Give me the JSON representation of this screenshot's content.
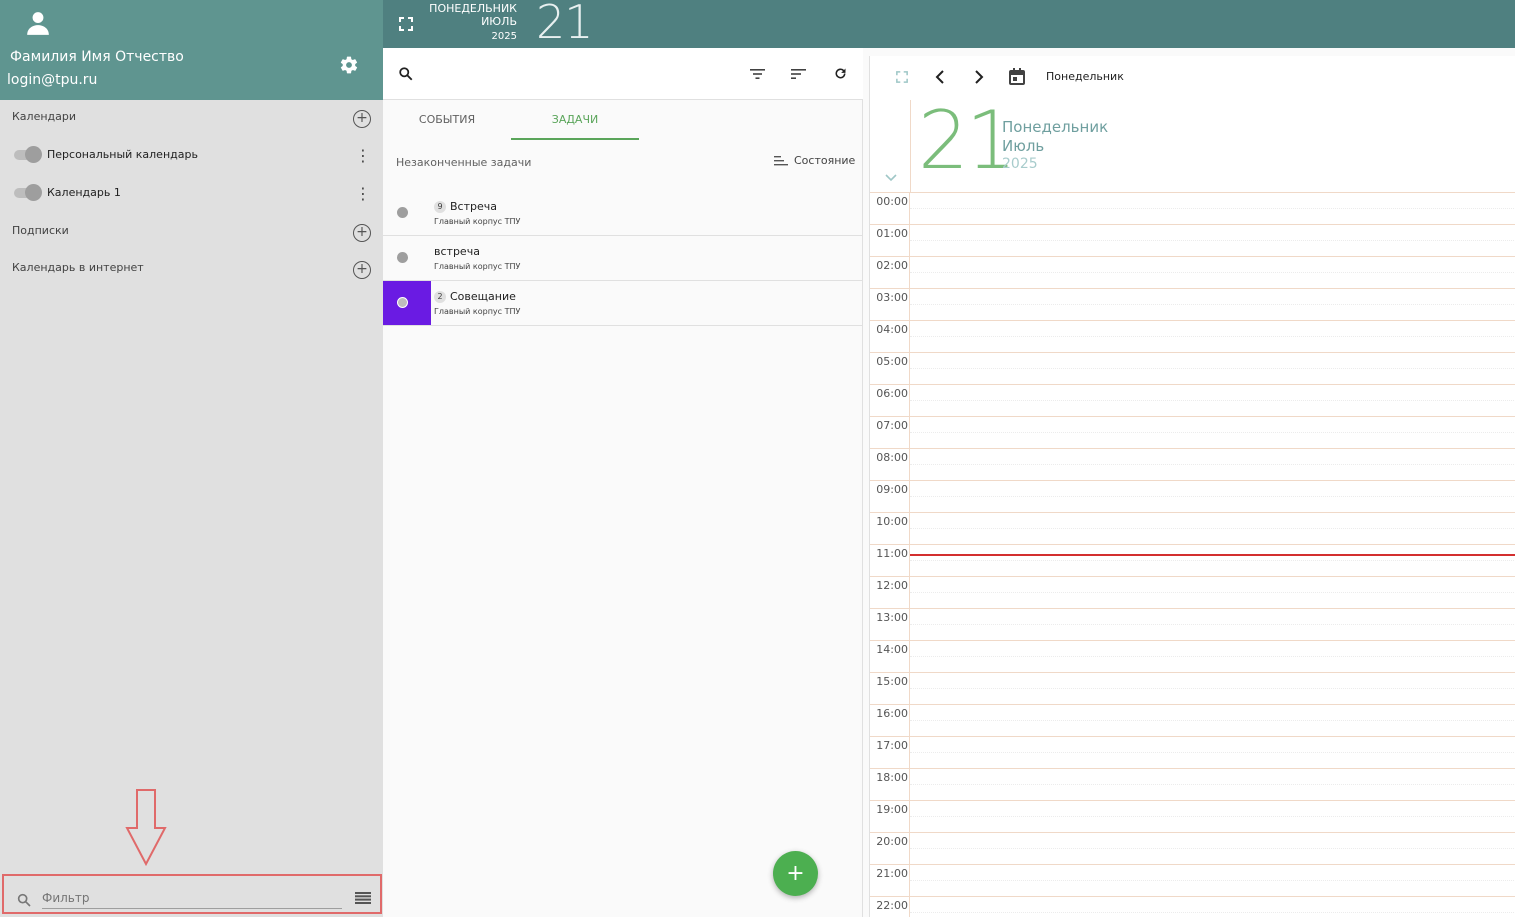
{
  "user": {
    "name": "Фамилия Имя Отчество",
    "email": "login@tpu.ru"
  },
  "sidebar": {
    "calendars_title": "Календари",
    "calendars": [
      {
        "label": "Персональный календарь",
        "enabled": false
      },
      {
        "label": "Календарь 1",
        "enabled": false
      }
    ],
    "subscriptions_title": "Подписки",
    "internet_title": "Календарь в интернет",
    "filter_placeholder": "Фильтр"
  },
  "topbar": {
    "weekday": "ПОНЕДЕЛЬНИК",
    "month": "ИЮЛЬ",
    "year": "2025",
    "day": "21"
  },
  "tabs": [
    {
      "label": "СОБЫТИЯ",
      "active": false
    },
    {
      "label": "ЗАДАЧИ",
      "active": true
    }
  ],
  "tasks_panel": {
    "header": "Незаконченные задачи",
    "state_button": "Состояние",
    "tasks": [
      {
        "badge": "9",
        "title": "Встреча",
        "location": "Главный корпус ТПУ",
        "selected": false
      },
      {
        "badge": "",
        "title": "встреча",
        "location": "Главный корпус ТПУ",
        "selected": false
      },
      {
        "badge": "2",
        "title": "Совещание",
        "location": "Главный корпус ТПУ",
        "selected": true,
        "color": "#6a1be3"
      }
    ],
    "fab_label": "+"
  },
  "calendar_view": {
    "toolbar_title": "Понедельник",
    "day": "21",
    "weekday": "Понедельник",
    "month": "Июль",
    "year": "2025",
    "hours": [
      "00:00",
      "01:00",
      "02:00",
      "03:00",
      "04:00",
      "05:00",
      "06:00",
      "07:00",
      "08:00",
      "09:00",
      "10:00",
      "11:00",
      "12:00",
      "13:00",
      "14:00",
      "15:00",
      "16:00",
      "17:00",
      "18:00",
      "19:00",
      "20:00",
      "21:00",
      "22:00"
    ],
    "current_time": "11:00"
  },
  "colors": {
    "header": "#4f8080",
    "profile": "#5f9590",
    "accent": "#5aa55a",
    "fab": "#4caf50",
    "now_line": "#d32f2f"
  }
}
